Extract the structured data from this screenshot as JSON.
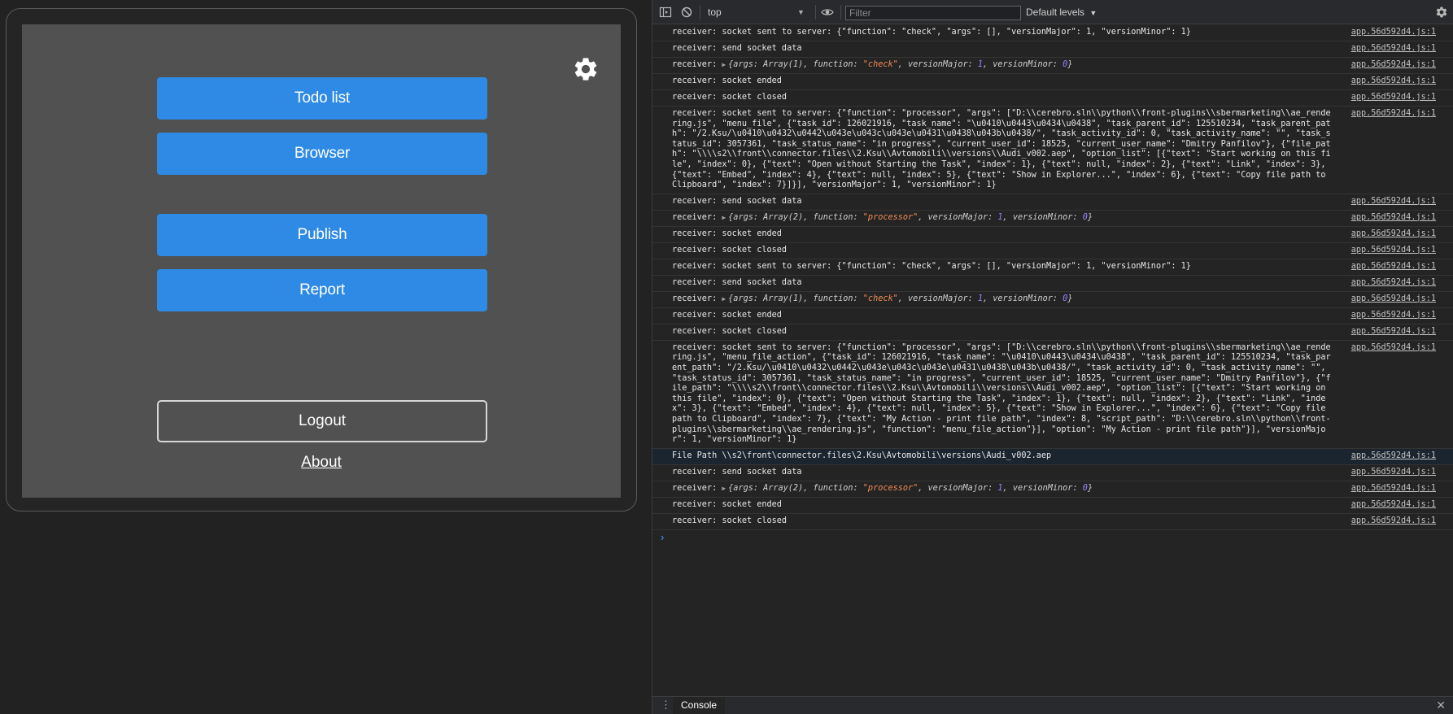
{
  "app": {
    "buttons": {
      "todo": "Todo list",
      "browser": "Browser",
      "publish": "Publish",
      "report": "Report",
      "logout": "Logout"
    },
    "about": "About",
    "settings_icon": "gear-icon"
  },
  "devtools": {
    "toolbar": {
      "context": "top",
      "filter_placeholder": "Filter",
      "levels": "Default levels"
    },
    "source": "app.56d592d4.js:1",
    "logs": [
      {
        "type": "text",
        "text": "receiver: socket sent to server: {\"function\": \"check\", \"args\": [], \"versionMajor\": 1, \"versionMinor\": 1}"
      },
      {
        "type": "text",
        "text": "receiver: send socket data"
      },
      {
        "type": "object",
        "prefix": "receiver: ",
        "args": "Array(1)",
        "function": "\"check\"",
        "versionMajor": "1",
        "versionMinor": "0"
      },
      {
        "type": "text",
        "text": "receiver: socket ended"
      },
      {
        "type": "text",
        "text": "receiver: socket closed"
      },
      {
        "type": "text",
        "text": "receiver: socket sent to server: {\"function\": \"processor\", \"args\": [\"D:\\\\cerebro.sln\\\\python\\\\front-plugins\\\\sbermarketing\\\\ae_rendering.js\", \"menu_file\", {\"task_id\": 126021916, \"task_name\": \"\\u0410\\u0443\\u0434\\u0438\", \"task_parent_id\": 125510234, \"task_parent_path\": \"/2.Ksu/\\u0410\\u0432\\u0442\\u043e\\u043c\\u043e\\u0431\\u0438\\u043b\\u0438/\", \"task_activity_id\": 0, \"task_activity_name\": \"\", \"task_status_id\": 3057361, \"task_status_name\": \"in progress\", \"current_user_id\": 18525, \"current_user_name\": \"Dmitry Panfilov\"}, {\"file_path\": \"\\\\\\\\s2\\\\front\\\\connector.files\\\\2.Ksu\\\\Avtomobili\\\\versions\\\\Audi_v002.aep\", \"option_list\": [{\"text\": \"Start working on this file\", \"index\": 0}, {\"text\": \"Open without Starting the Task\", \"index\": 1}, {\"text\": null, \"index\": 2}, {\"text\": \"Link\", \"index\": 3}, {\"text\": \"Embed\", \"index\": 4}, {\"text\": null, \"index\": 5}, {\"text\": \"Show in Explorer...\", \"index\": 6}, {\"text\": \"Copy file path to Clipboard\", \"index\": 7}]}], \"versionMajor\": 1, \"versionMinor\": 1}"
      },
      {
        "type": "text",
        "text": "receiver: send socket data"
      },
      {
        "type": "object",
        "prefix": "receiver: ",
        "args": "Array(2)",
        "function": "\"processor\"",
        "versionMajor": "1",
        "versionMinor": "0"
      },
      {
        "type": "text",
        "text": "receiver: socket ended"
      },
      {
        "type": "text",
        "text": "receiver: socket closed"
      },
      {
        "type": "text",
        "text": "receiver: socket sent to server: {\"function\": \"check\", \"args\": [], \"versionMajor\": 1, \"versionMinor\": 1}"
      },
      {
        "type": "text",
        "text": "receiver: send socket data"
      },
      {
        "type": "object",
        "prefix": "receiver: ",
        "args": "Array(1)",
        "function": "\"check\"",
        "versionMajor": "1",
        "versionMinor": "0"
      },
      {
        "type": "text",
        "text": "receiver: socket ended"
      },
      {
        "type": "text",
        "text": "receiver: socket closed"
      },
      {
        "type": "text",
        "text": "receiver: socket sent to server: {\"function\": \"processor\", \"args\": [\"D:\\\\cerebro.sln\\\\python\\\\front-plugins\\\\sbermarketing\\\\ae_rendering.js\", \"menu_file_action\", {\"task_id\": 126021916, \"task_name\": \"\\u0410\\u0443\\u0434\\u0438\", \"task_parent_id\": 125510234, \"task_parent_path\": \"/2.Ksu/\\u0410\\u0432\\u0442\\u043e\\u043c\\u043e\\u0431\\u0438\\u043b\\u0438/\", \"task_activity_id\": 0, \"task_activity_name\": \"\", \"task_status_id\": 3057361, \"task_status_name\": \"in progress\", \"current_user_id\": 18525, \"current_user_name\": \"Dmitry Panfilov\"}, {\"file_path\": \"\\\\\\\\s2\\\\front\\\\connector.files\\\\2.Ksu\\\\Avtomobili\\\\versions\\\\Audi_v002.aep\", \"option_list\": [{\"text\": \"Start working on this file\", \"index\": 0}, {\"text\": \"Open without Starting the Task\", \"index\": 1}, {\"text\": null, \"index\": 2}, {\"text\": \"Link\", \"index\": 3}, {\"text\": \"Embed\", \"index\": 4}, {\"text\": null, \"index\": 5}, {\"text\": \"Show in Explorer...\", \"index\": 6}, {\"text\": \"Copy file path to Clipboard\", \"index\": 7}, {\"text\": \"My Action - print file path\", \"index\": 8, \"script_path\": \"D:\\\\cerebro.sln\\\\python\\\\front-plugins\\\\sbermarketing\\\\ae_rendering.js\", \"function\": \"menu_file_action\"}], \"option\": \"My Action - print file path\"}], \"versionMajor\": 1, \"versionMinor\": 1}"
      },
      {
        "type": "text",
        "text": "File Path \\\\s2\\front\\connector.files\\2.Ksu\\Avtomobili\\versions\\Audi_v002.aep",
        "highlight": true
      },
      {
        "type": "text",
        "text": "receiver: send socket data"
      },
      {
        "type": "object",
        "prefix": "receiver: ",
        "args": "Array(2)",
        "function": "\"processor\"",
        "versionMajor": "1",
        "versionMinor": "0"
      },
      {
        "type": "text",
        "text": "receiver: socket ended"
      },
      {
        "type": "text",
        "text": "receiver: socket closed"
      }
    ],
    "drawer": {
      "tab": "Console"
    }
  }
}
